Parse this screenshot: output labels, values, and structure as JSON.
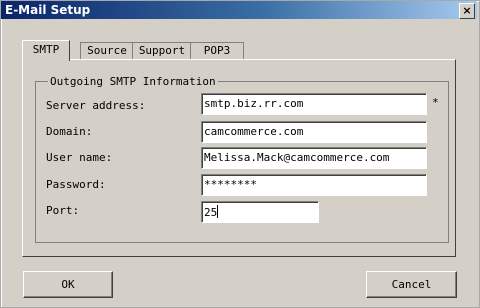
{
  "window": {
    "title": "E-Mail Setup",
    "close_icon": "close-icon"
  },
  "tabs": [
    {
      "label": "SMTP",
      "active": true
    },
    {
      "label": "Source",
      "active": false
    },
    {
      "label": "Support",
      "active": false
    },
    {
      "label": "POP3",
      "active": false
    }
  ],
  "group": {
    "title": "Outgoing SMTP Information",
    "fields": [
      {
        "label": "Server address:",
        "value": "smtp.biz.rr.com",
        "required_marker": "*"
      },
      {
        "label": "Domain:",
        "value": "camcommerce.com"
      },
      {
        "label": "User name:",
        "value": "Melissa.Mack@camcommerce.com"
      },
      {
        "label": "Password:",
        "value": "********"
      },
      {
        "label": "Port:",
        "value": "25"
      }
    ]
  },
  "buttons": {
    "ok": "OK",
    "cancel": "Cancel"
  }
}
